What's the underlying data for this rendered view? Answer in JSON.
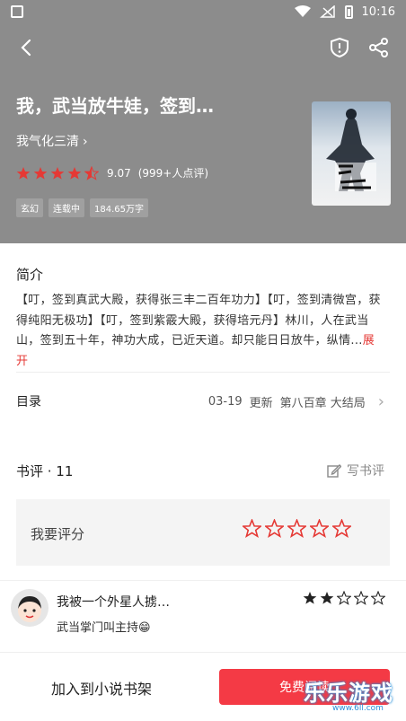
{
  "status_bar": {
    "time": "10:16"
  },
  "book": {
    "title": "我，武当放牛娃，签到…",
    "author": "我气化三清",
    "rating_score": "9.07",
    "rating_count": "(999+人点评)",
    "stars": 4.5,
    "tags": [
      "玄幻",
      "连载中",
      "184.65万字"
    ]
  },
  "intro": {
    "heading": "简介",
    "text": "【叮，签到真武大殿，获得张三丰二百年功力】【叮，签到清微宫，获得纯阳无极功】【叮，签到紫霰大殿，获得培元丹】林川，人在武当山，签到五十年，神功大成，已近天道。却只能日日放牛，纵情...",
    "expand_label": "展开"
  },
  "toc": {
    "label": "目录",
    "date": "03-19",
    "update_label": "更新",
    "latest_chapter": "第八百章 大结局"
  },
  "reviews": {
    "header": "书评 · 11",
    "write_label": "写书评",
    "rate_prompt": "我要评分",
    "comment": {
      "user": "我被一个外星人掳…",
      "text": "武当掌门叫主持😁",
      "stars": 2
    }
  },
  "bottom": {
    "add_shelf_label": "加入到小说书架",
    "read_label": "免费阅读"
  },
  "watermark": {
    "text": "乐乐游戏",
    "sub": "www.6ll.com"
  },
  "colors": {
    "accent": "#f43a45",
    "hero_bg": "#8c8c8c",
    "star_red": "#e53935"
  }
}
